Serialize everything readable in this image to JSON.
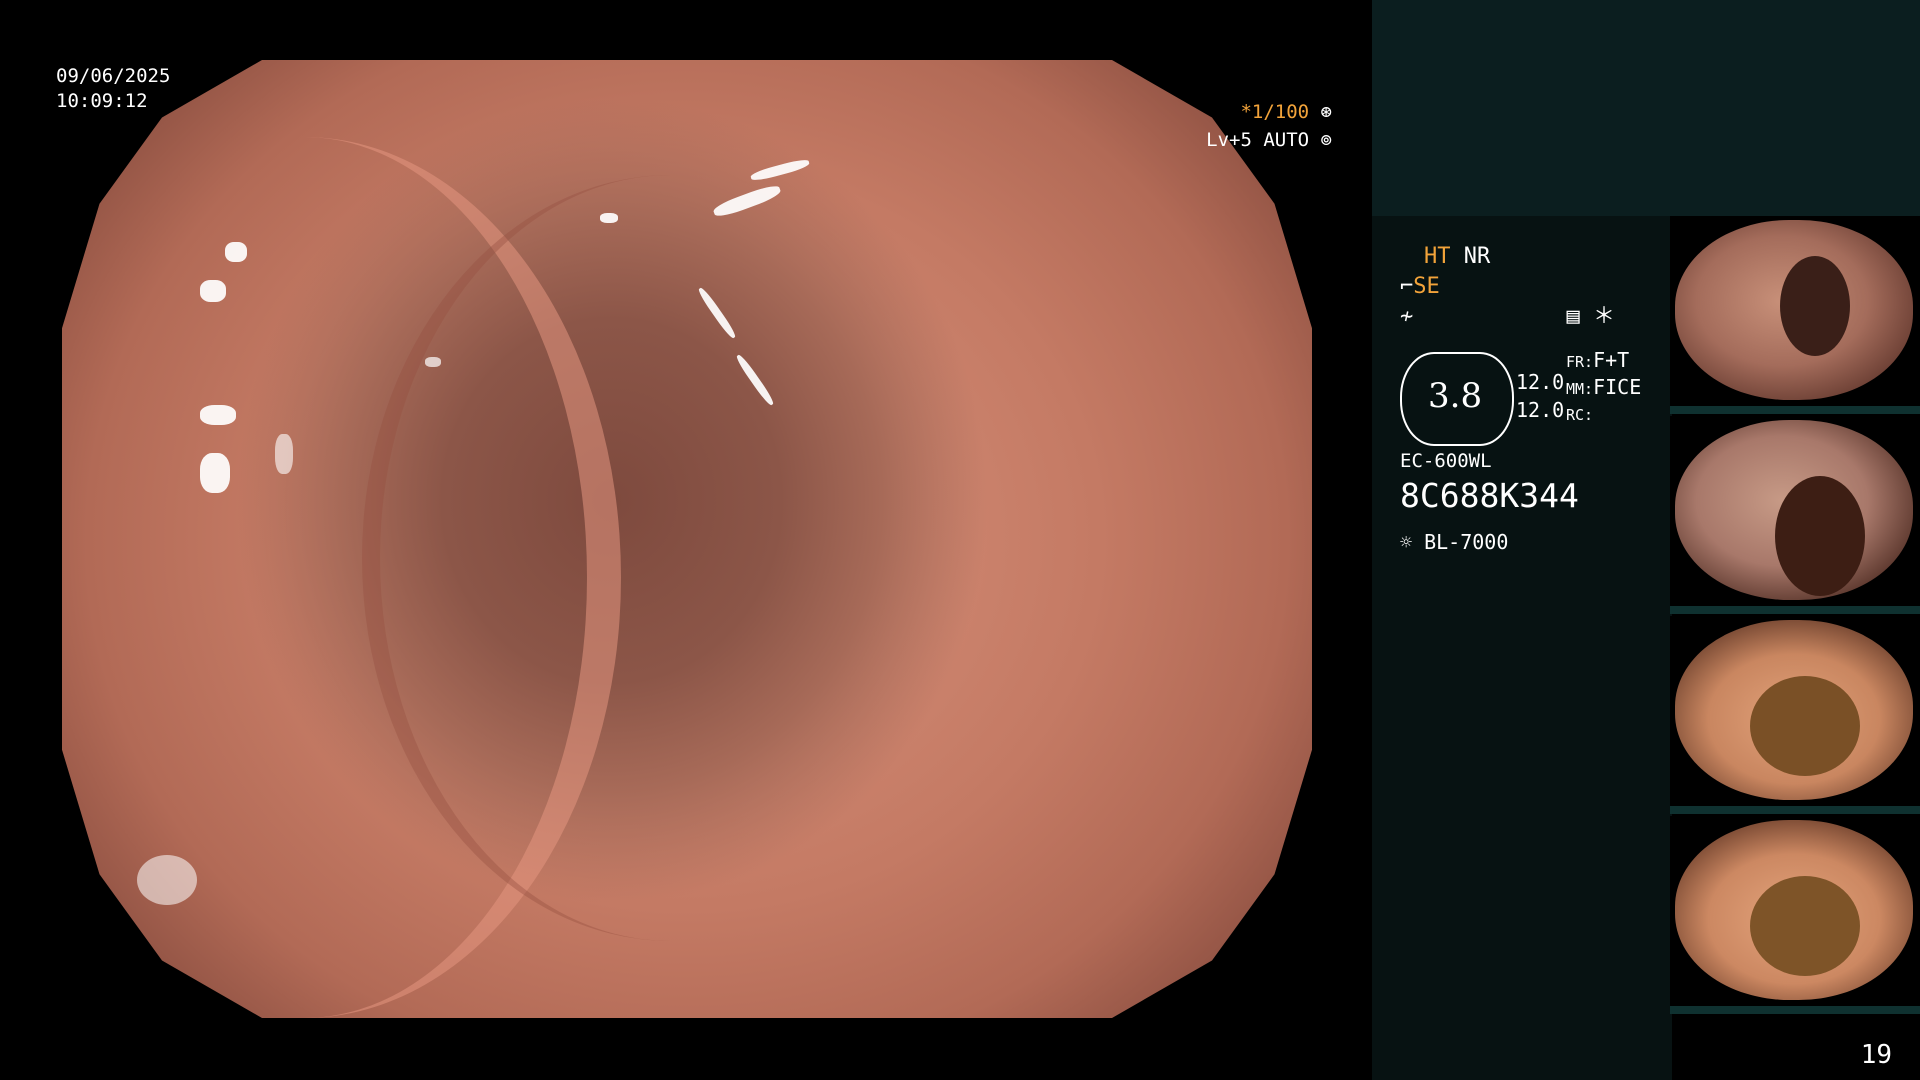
{
  "overlay": {
    "date": "09/06/2025",
    "time": "10:09:12",
    "shutter": "*1/100",
    "level": "Lv+5 AUTO"
  },
  "info_panel": {
    "ht": "HT",
    "nr": "NR",
    "se": "SE",
    "dial_value": "3.8",
    "val1": "12.0",
    "val2": "12.0",
    "fr_label": "FR:",
    "fr_value": "F+T",
    "mm_label": "MM:",
    "mm_value": "FICE",
    "rc_label": "RC:",
    "scope_model": "EC-600WL",
    "serial": "8C688K344",
    "light_source": "BL-7000"
  },
  "thumbnails": [
    {
      "name": "thumb-1"
    },
    {
      "name": "thumb-2"
    },
    {
      "name": "thumb-3"
    },
    {
      "name": "thumb-4"
    }
  ],
  "page_number": "19",
  "colors": {
    "accent": "#f2a33a",
    "panel_top": "#0b1e1f",
    "panel_info": "#071212"
  }
}
